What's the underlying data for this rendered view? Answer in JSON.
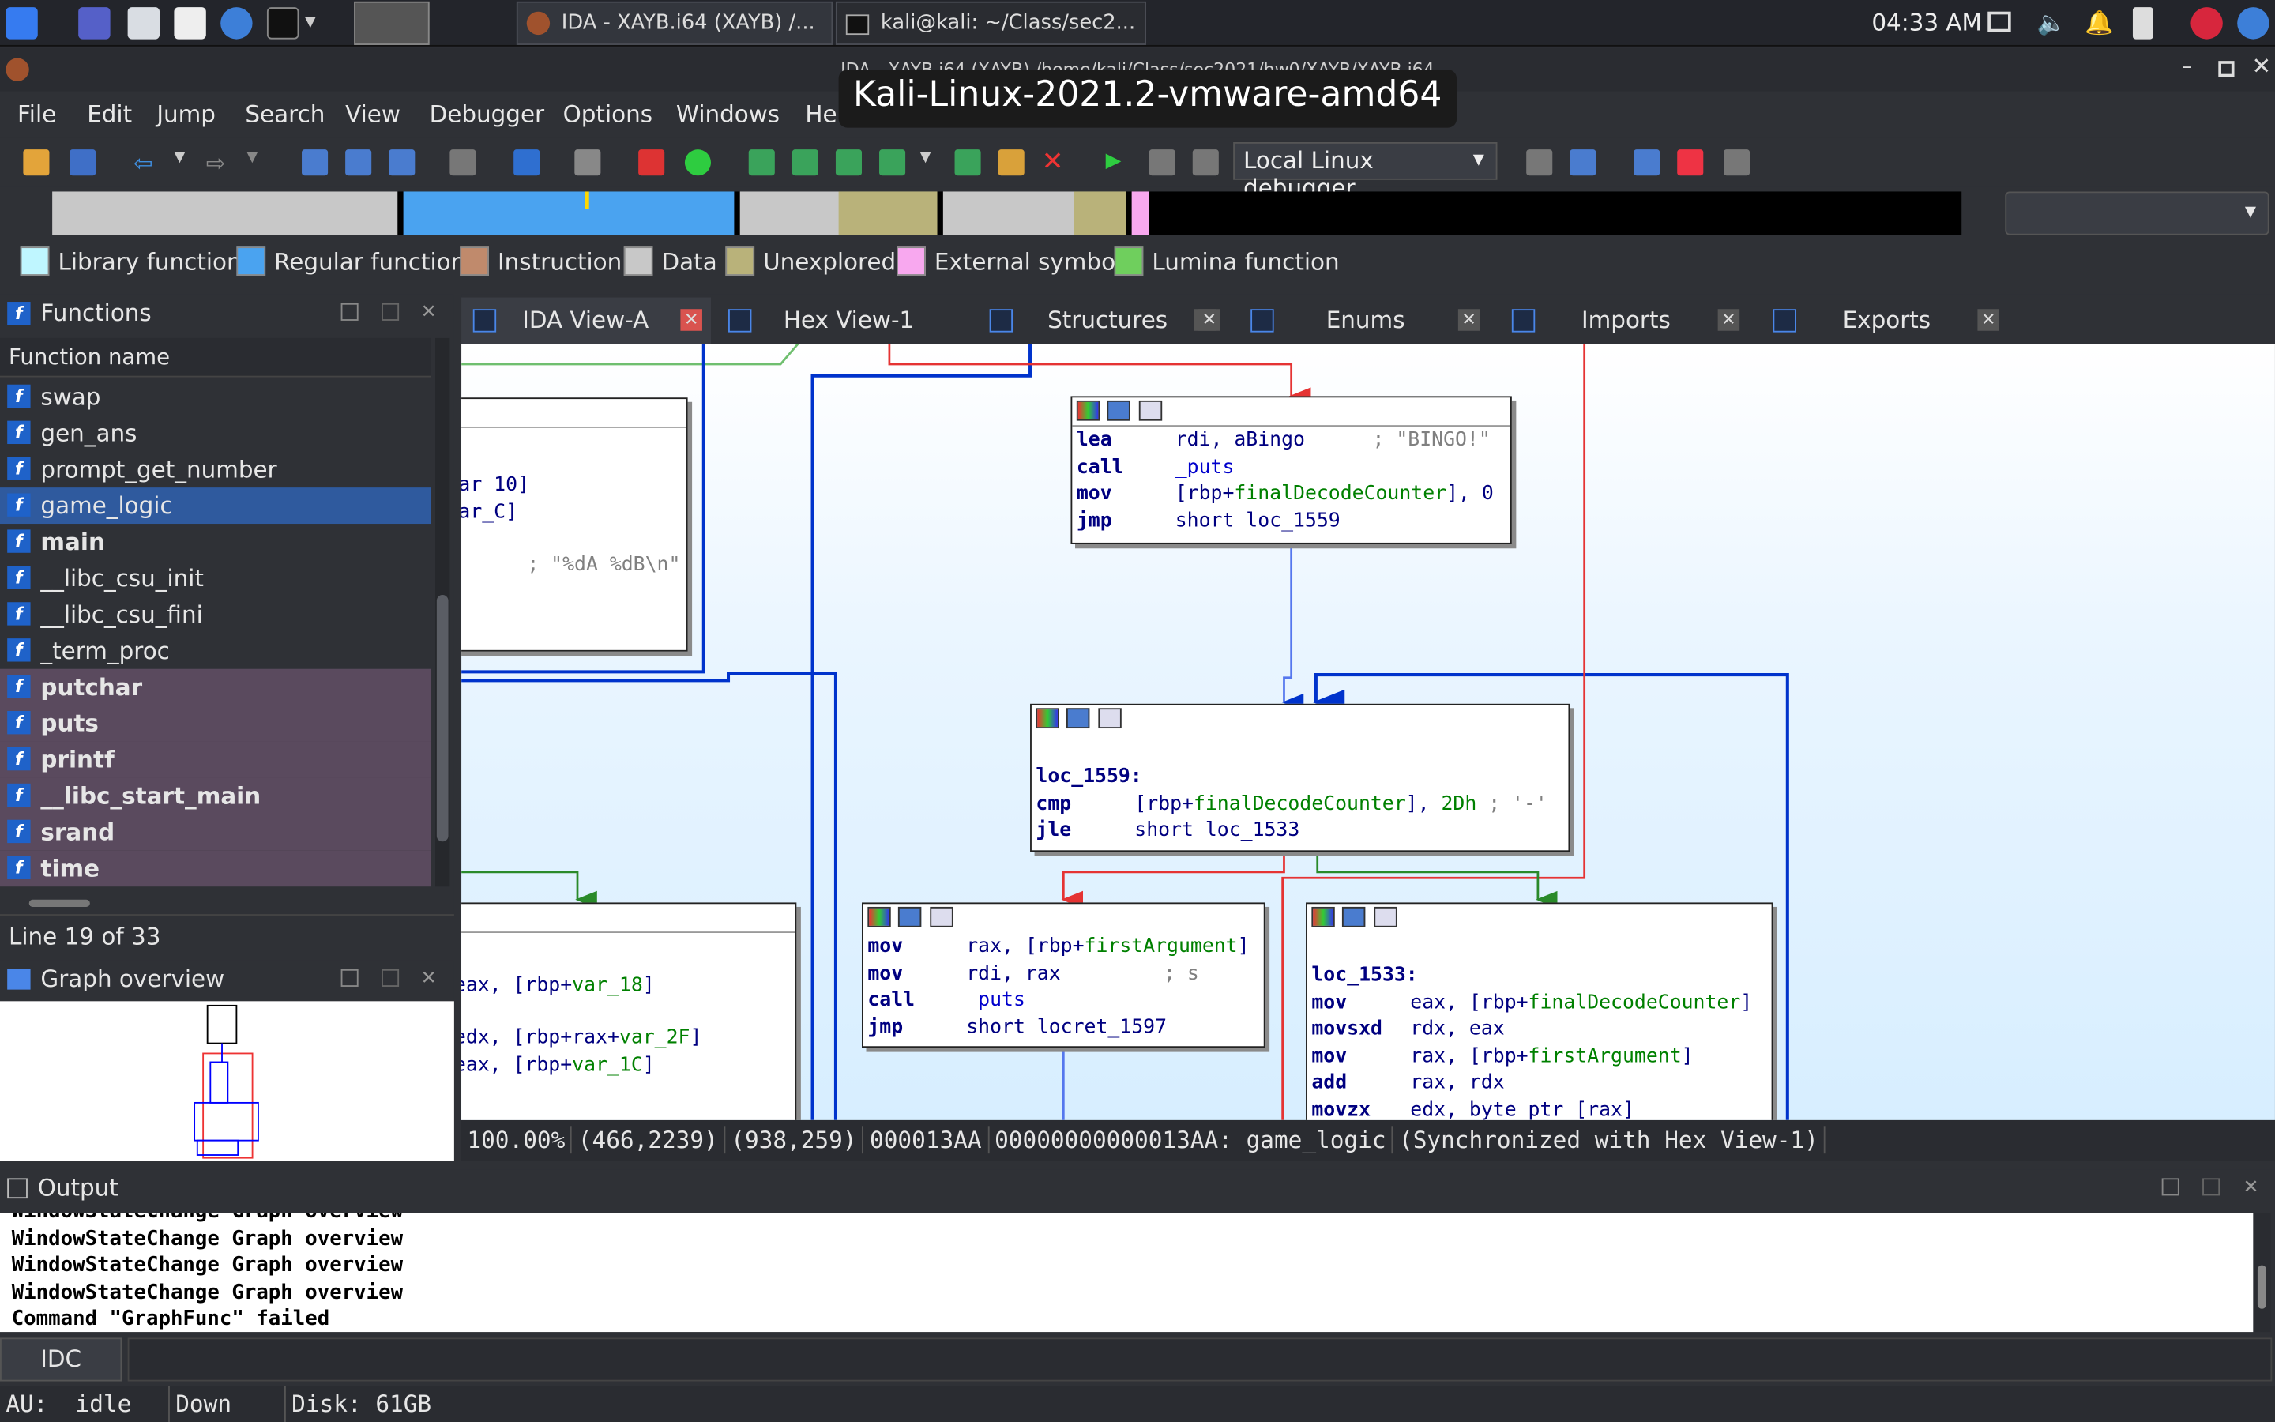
{
  "taskbar": {
    "tasks": [
      "IDA - XAYB.i64 (XAYB) /...",
      "kali@kali: ~/Class/sec2..."
    ],
    "clock": "04:33 AM"
  },
  "window": {
    "title": "IDA - XAYB.i64 (XAYB) /home/kali/Class/sec2021/hw0/XAYB/XAYB.i64"
  },
  "osd": "Kali-Linux-2021.2-vmware-amd64",
  "menu": [
    "File",
    "Edit",
    "Jump",
    "Search",
    "View",
    "Debugger",
    "Options",
    "Windows",
    "Help"
  ],
  "toolbar": {
    "debugger": "Local Linux debugger"
  },
  "legend": [
    "Library function",
    "Regular function",
    "Instruction",
    "Data",
    "Unexplored",
    "External symbol",
    "Lumina function"
  ],
  "legend_colors": [
    "#bff6ff",
    "#4aa3f0",
    "#c08a6c",
    "#c8c8c8",
    "#b9b27a",
    "#f8a8ef",
    "#6fcf5d"
  ],
  "functions_panel": {
    "title": "Functions",
    "column": "Function name",
    "items": [
      "swap",
      "gen_ans",
      "prompt_get_number",
      "game_logic",
      "main",
      "__libc_csu_init",
      "__libc_csu_fini",
      "_term_proc",
      "putchar",
      "puts",
      "printf",
      "__libc_start_main",
      "srand",
      "time"
    ],
    "status": "Line 19 of 33"
  },
  "graph_overview": {
    "title": "Graph overview"
  },
  "tabs": [
    "IDA View-A",
    "Hex View-1",
    "Structures",
    "Enums",
    "Imports",
    "Exports"
  ],
  "nodes": {
    "left_top": {
      "l1": "ar_10]",
      "l2": "ar_C]",
      "l3": "; \"%dA %dB\\n\""
    },
    "bingo": {
      "l1_op": "lea",
      "l1_a": "rdi, aBingo",
      "l1_c": "; \"BINGO!\"",
      "l2_op": "call",
      "l2_a": "_puts",
      "l3_op": "mov",
      "l3_a": "[rbp+",
      "l3_v": "finalDecodeCounter",
      "l3_b": "], 0",
      "l4_op": "jmp",
      "l4_a": "short loc_1559"
    },
    "loc1559": {
      "label": "loc_1559:",
      "l1_op": "cmp",
      "l1_a": "[rbp+",
      "l1_v": "finalDecodeCounter",
      "l1_b": "], ",
      "l1_n": "2Dh",
      "l1_c": " ; '-'",
      "l2_op": "jle",
      "l2_a": "short loc_1533"
    },
    "putsnode": {
      "l1_op": "mov",
      "l1_a": "rax, [rbp+",
      "l1_v": "firstArgument",
      "l1_b": "]",
      "l2_op": "mov",
      "l2_a": "rdi, rax",
      "l2_c": "; s",
      "l3_op": "call",
      "l3_a": "_puts",
      "l4_op": "jmp",
      "l4_a": "short locret_1597"
    },
    "loc1533": {
      "label": "loc_1533:",
      "l1_op": "mov",
      "l1_a": "eax, [rbp+",
      "l1_v": "finalDecodeCounter",
      "l1_b": "]",
      "l2_op": "movsxd",
      "l2_a": "rdx, eax",
      "l3_op": "mov",
      "l3_a": "rax, [rbp+",
      "l3_v": "firstArgument",
      "l3_b": "]",
      "l4_op": "add",
      "l4_a": "rax, rdx",
      "l5_op": "movzx",
      "l5_a": "edx, byte ptr [rax]"
    },
    "left_bottom": {
      "l1": ":",
      "l2a": "eax, [rbp+",
      "l2v": "var_18",
      "l2b": "]",
      "l3a": "edx, [rbp+rax+",
      "l3v": "var_2F",
      "l3b": "]",
      "l4a": "eax, [rbp+",
      "l4v": "var_1C",
      "l4b": "]"
    }
  },
  "statusline": [
    "100.00%",
    "(466,2239)",
    "(938,259)",
    "000013AA",
    "00000000000013AA: game_logic",
    "(Synchronized with Hex View-1)"
  ],
  "output": {
    "title": "Output",
    "lines": [
      "WindowStateChange Graph overview",
      "WindowStateChange Graph overview",
      "WindowStateChange Graph overview",
      "WindowStateChange Graph overview",
      "Command \"GraphFunc\" failed"
    ],
    "idc": "IDC"
  },
  "bottom_status": {
    "au": "AU:",
    "state": "idle",
    "dir": "Down",
    "disk": "Disk: 61GB"
  }
}
